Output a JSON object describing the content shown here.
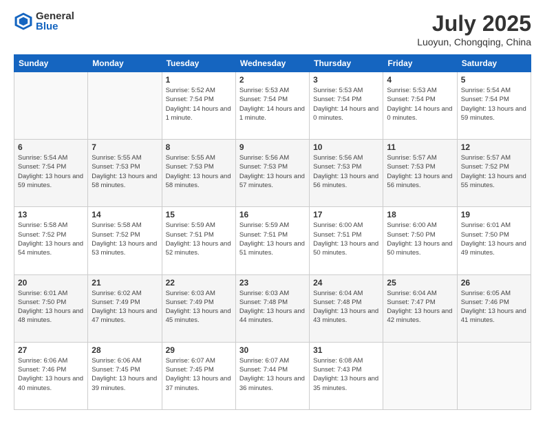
{
  "header": {
    "logo_general": "General",
    "logo_blue": "Blue",
    "month_title": "July 2025",
    "location": "Luoyun, Chongqing, China"
  },
  "days_of_week": [
    "Sunday",
    "Monday",
    "Tuesday",
    "Wednesday",
    "Thursday",
    "Friday",
    "Saturday"
  ],
  "weeks": [
    [
      {
        "day": "",
        "info": ""
      },
      {
        "day": "",
        "info": ""
      },
      {
        "day": "1",
        "info": "Sunrise: 5:52 AM\nSunset: 7:54 PM\nDaylight: 14 hours and 1 minute."
      },
      {
        "day": "2",
        "info": "Sunrise: 5:53 AM\nSunset: 7:54 PM\nDaylight: 14 hours and 1 minute."
      },
      {
        "day": "3",
        "info": "Sunrise: 5:53 AM\nSunset: 7:54 PM\nDaylight: 14 hours and 0 minutes."
      },
      {
        "day": "4",
        "info": "Sunrise: 5:53 AM\nSunset: 7:54 PM\nDaylight: 14 hours and 0 minutes."
      },
      {
        "day": "5",
        "info": "Sunrise: 5:54 AM\nSunset: 7:54 PM\nDaylight: 13 hours and 59 minutes."
      }
    ],
    [
      {
        "day": "6",
        "info": "Sunrise: 5:54 AM\nSunset: 7:54 PM\nDaylight: 13 hours and 59 minutes."
      },
      {
        "day": "7",
        "info": "Sunrise: 5:55 AM\nSunset: 7:53 PM\nDaylight: 13 hours and 58 minutes."
      },
      {
        "day": "8",
        "info": "Sunrise: 5:55 AM\nSunset: 7:53 PM\nDaylight: 13 hours and 58 minutes."
      },
      {
        "day": "9",
        "info": "Sunrise: 5:56 AM\nSunset: 7:53 PM\nDaylight: 13 hours and 57 minutes."
      },
      {
        "day": "10",
        "info": "Sunrise: 5:56 AM\nSunset: 7:53 PM\nDaylight: 13 hours and 56 minutes."
      },
      {
        "day": "11",
        "info": "Sunrise: 5:57 AM\nSunset: 7:53 PM\nDaylight: 13 hours and 56 minutes."
      },
      {
        "day": "12",
        "info": "Sunrise: 5:57 AM\nSunset: 7:52 PM\nDaylight: 13 hours and 55 minutes."
      }
    ],
    [
      {
        "day": "13",
        "info": "Sunrise: 5:58 AM\nSunset: 7:52 PM\nDaylight: 13 hours and 54 minutes."
      },
      {
        "day": "14",
        "info": "Sunrise: 5:58 AM\nSunset: 7:52 PM\nDaylight: 13 hours and 53 minutes."
      },
      {
        "day": "15",
        "info": "Sunrise: 5:59 AM\nSunset: 7:51 PM\nDaylight: 13 hours and 52 minutes."
      },
      {
        "day": "16",
        "info": "Sunrise: 5:59 AM\nSunset: 7:51 PM\nDaylight: 13 hours and 51 minutes."
      },
      {
        "day": "17",
        "info": "Sunrise: 6:00 AM\nSunset: 7:51 PM\nDaylight: 13 hours and 50 minutes."
      },
      {
        "day": "18",
        "info": "Sunrise: 6:00 AM\nSunset: 7:50 PM\nDaylight: 13 hours and 50 minutes."
      },
      {
        "day": "19",
        "info": "Sunrise: 6:01 AM\nSunset: 7:50 PM\nDaylight: 13 hours and 49 minutes."
      }
    ],
    [
      {
        "day": "20",
        "info": "Sunrise: 6:01 AM\nSunset: 7:50 PM\nDaylight: 13 hours and 48 minutes."
      },
      {
        "day": "21",
        "info": "Sunrise: 6:02 AM\nSunset: 7:49 PM\nDaylight: 13 hours and 47 minutes."
      },
      {
        "day": "22",
        "info": "Sunrise: 6:03 AM\nSunset: 7:49 PM\nDaylight: 13 hours and 45 minutes."
      },
      {
        "day": "23",
        "info": "Sunrise: 6:03 AM\nSunset: 7:48 PM\nDaylight: 13 hours and 44 minutes."
      },
      {
        "day": "24",
        "info": "Sunrise: 6:04 AM\nSunset: 7:48 PM\nDaylight: 13 hours and 43 minutes."
      },
      {
        "day": "25",
        "info": "Sunrise: 6:04 AM\nSunset: 7:47 PM\nDaylight: 13 hours and 42 minutes."
      },
      {
        "day": "26",
        "info": "Sunrise: 6:05 AM\nSunset: 7:46 PM\nDaylight: 13 hours and 41 minutes."
      }
    ],
    [
      {
        "day": "27",
        "info": "Sunrise: 6:06 AM\nSunset: 7:46 PM\nDaylight: 13 hours and 40 minutes."
      },
      {
        "day": "28",
        "info": "Sunrise: 6:06 AM\nSunset: 7:45 PM\nDaylight: 13 hours and 39 minutes."
      },
      {
        "day": "29",
        "info": "Sunrise: 6:07 AM\nSunset: 7:45 PM\nDaylight: 13 hours and 37 minutes."
      },
      {
        "day": "30",
        "info": "Sunrise: 6:07 AM\nSunset: 7:44 PM\nDaylight: 13 hours and 36 minutes."
      },
      {
        "day": "31",
        "info": "Sunrise: 6:08 AM\nSunset: 7:43 PM\nDaylight: 13 hours and 35 minutes."
      },
      {
        "day": "",
        "info": ""
      },
      {
        "day": "",
        "info": ""
      }
    ]
  ]
}
